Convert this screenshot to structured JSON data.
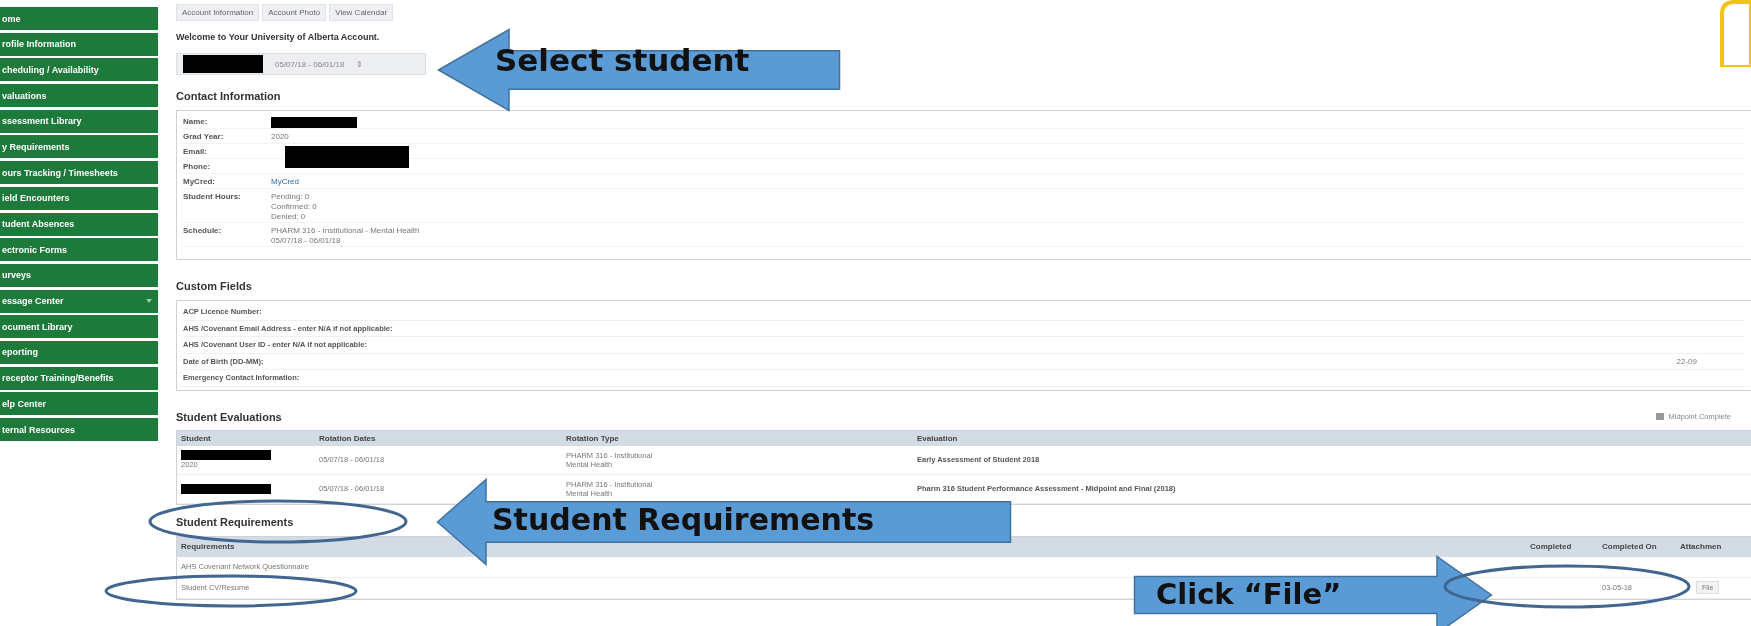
{
  "sidebar": {
    "items": [
      {
        "label": "ome",
        "has_submenu": false
      },
      {
        "label": "rofile Information",
        "has_submenu": false
      },
      {
        "label": "cheduling / Availability",
        "has_submenu": false
      },
      {
        "label": "valuations",
        "has_submenu": false
      },
      {
        "label": "ssessment Library",
        "has_submenu": false
      },
      {
        "label": "y Requirements",
        "has_submenu": false
      },
      {
        "label": "ours Tracking / Timesheets",
        "has_submenu": false
      },
      {
        "label": "ield Encounters",
        "has_submenu": false
      },
      {
        "label": "tudent Absences",
        "has_submenu": false
      },
      {
        "label": "ectronic Forms",
        "has_submenu": false
      },
      {
        "label": "urveys",
        "has_submenu": false
      },
      {
        "label": "essage Center",
        "has_submenu": true
      },
      {
        "label": "ocument Library",
        "has_submenu": false
      },
      {
        "label": "eporting",
        "has_submenu": false
      },
      {
        "label": "receptor Training/Benefits",
        "has_submenu": false
      },
      {
        "label": "elp Center",
        "has_submenu": false
      },
      {
        "label": "ternal Resources",
        "has_submenu": false
      }
    ]
  },
  "top_tabs": [
    "Account Information",
    "Account Photo",
    "View Calendar"
  ],
  "welcome": "Welcome to Your University of Alberta Account.",
  "student_select": {
    "value": "05/07/18 - 06/01/18",
    "arrows": "⇕"
  },
  "contact": {
    "title": "Contact Information",
    "rows": [
      {
        "label": "Name:",
        "kind": "redacted"
      },
      {
        "label": "Grad Year:",
        "kind": "text",
        "lines": [
          "2020"
        ]
      },
      {
        "label": "Email:",
        "kind": "redacted_span"
      },
      {
        "label": "Phone:",
        "kind": "empty"
      },
      {
        "label": "MyCred:",
        "kind": "link",
        "lines": [
          "MyCred"
        ]
      },
      {
        "label": "Student Hours:",
        "kind": "text",
        "lines": [
          "Pending: 0",
          "Confirmed: 0",
          "Denied: 0"
        ]
      },
      {
        "label": "Schedule:",
        "kind": "text",
        "lines": [
          "PHARM 316 - Institutional - Mental Health",
          "05/07/18 - 06/01/18"
        ]
      }
    ]
  },
  "custom_fields": {
    "title": "Custom Fields",
    "rows": [
      {
        "label": "ACP Licence Number:"
      },
      {
        "label": "AHS /Covenant Email Address - enter N/A if not applicable:"
      },
      {
        "label": "AHS /Covenant User ID - enter N/A if not applicable:"
      },
      {
        "label": "Date of Birth (DD-MM):",
        "value": "22-09"
      },
      {
        "label": "Emergency Contact Information:"
      }
    ]
  },
  "evaluations": {
    "title": "Student Evaluations",
    "legend": "Midpoint Complete",
    "columns": [
      "Student",
      "Rotation Dates",
      "Rotation Type",
      "Evaluation"
    ],
    "rows": [
      {
        "year": "2020",
        "dates": "05/07/18 - 06/01/18",
        "type": [
          "PHARM 316 - Institutional",
          "Mental Health"
        ],
        "evaluation": "Early Assessment of Student 2018"
      },
      {
        "dates": "05/07/18 - 06/01/18",
        "type": [
          "PHARM 316 - Institutional",
          "Mental Health"
        ],
        "evaluation": "Pharm 316 Student Performance Assessment - Midpoint and Final (2018)"
      }
    ]
  },
  "requirements": {
    "title": "Student Requirements",
    "columns": [
      "Requirements",
      "Completed",
      "Completed On",
      "Attachmen"
    ],
    "rows": [
      {
        "name": "AHS Covenant Network Questionnaire"
      },
      {
        "name": "Student CV/Resume",
        "completed_on": "03-05-18",
        "attachment": "File"
      }
    ]
  },
  "annotations": [
    {
      "kind": "left_arrow",
      "text": "Select student"
    },
    {
      "kind": "left_arrow",
      "text": "Student Requirements"
    },
    {
      "kind": "right_arrow",
      "text": "Click “File”"
    },
    {
      "kind": "ellipse"
    },
    {
      "kind": "ellipse"
    },
    {
      "kind": "ellipse"
    },
    {
      "kind": "edge_shape"
    }
  ]
}
